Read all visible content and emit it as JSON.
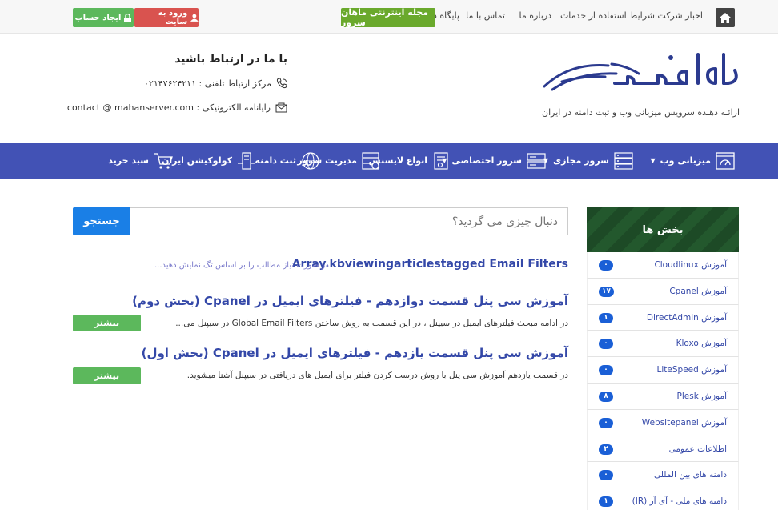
{
  "topbar": {
    "links": [
      "اخبار شرکت",
      "شرایط استفاده از خدمات",
      "درباره ما",
      "تماس با ما",
      "پایگاه دانش"
    ],
    "magazine_label": "مجله اینترنتی ماهان سرور",
    "login_label": "ورود به سایت",
    "signup_label": "ایجاد حساب"
  },
  "header": {
    "tagline": "ارائـه دهنده سرویس میزبانی وب و ثبت دامنه در ایران",
    "contact_title": "با ما در ارتباط باشید",
    "phone": "مرکز ارتباط تلفنی : ۰۲۱۴۷۶۲۴۲۱۱",
    "email": "رایانامه الکترونیکی : contact @ mahanserver.com"
  },
  "nav": {
    "items": [
      "میزبانی وب",
      "سرور مجازی",
      "سرور اختصاصی",
      "انواع لایسنس",
      "مدیریت سرور",
      "ثبت دامنه",
      "کولوکیشن ایران",
      "سبد خرید"
    ]
  },
  "search": {
    "placeholder": "دنبال چیزی می گردید؟",
    "button_label": "جستجو"
  },
  "tag_header": {
    "title": "Array.kbviewingarticlestagged Email Filters",
    "note": "در صورت نیاز مطالب را بر اساس تگ نمایش دهید..."
  },
  "articles": [
    {
      "title": "آموزش سی پنل قسمت دوازدهم - فیلترهای ایمیل در Cpanel (بخش دوم)",
      "desc": "در ادامه مبحث فیلترهای ایمیل در سیپنل ، در این قسمت به روش ساختن Global Email Filters در سیپنل می...",
      "more_label": "بیشتر"
    },
    {
      "title": "آموزش سی پنل قسمت یازدهم - فیلترهای ایمیل در Cpanel (بخش اول)",
      "desc": "در قسمت یازدهم آموزش سی پنل با روش درست کردن فیلتر برای ایمیل های دریافتی در سیپنل آشنا میشوید.",
      "more_label": "بیشتر"
    }
  ],
  "sidebar": {
    "title": "بخش ها",
    "items": [
      {
        "label": "آموزش Cloudlinux",
        "count": "۰"
      },
      {
        "label": "آموزش Cpanel",
        "count": "۱۷"
      },
      {
        "label": "آموزش DirectAdmin",
        "count": "۱"
      },
      {
        "label": "آموزش Kloxo",
        "count": "۰"
      },
      {
        "label": "آموزش LiteSpeed",
        "count": "۰"
      },
      {
        "label": "آموزش Plesk",
        "count": "۸"
      },
      {
        "label": "آموزش Websitepanel",
        "count": "۰"
      },
      {
        "label": "اطلاعات عمومی",
        "count": "۲"
      },
      {
        "label": "دامنه های بین المللی",
        "count": "۰"
      },
      {
        "label": "دامنه های ملی - آی آر (IR)",
        "count": "۱"
      }
    ]
  },
  "colors": {
    "nav_bg": "#4252b5",
    "link": "#3448a8",
    "green": "#5cb85c",
    "red": "#d9534f",
    "search_btn": "#1a7fe6"
  }
}
